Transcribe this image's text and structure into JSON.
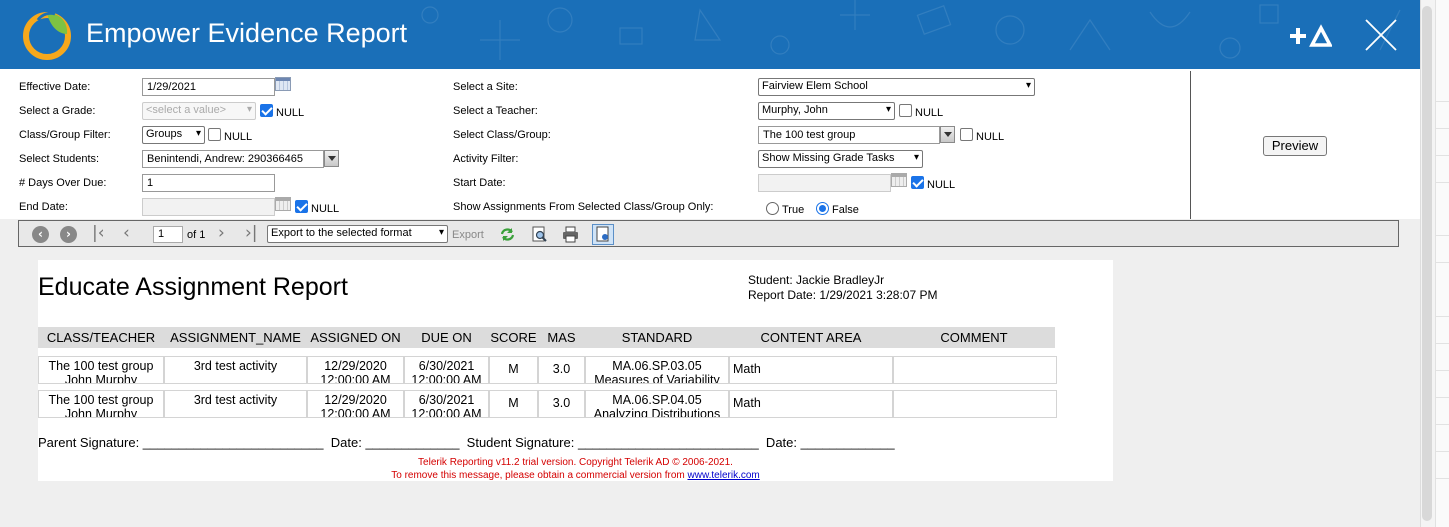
{
  "app": {
    "title": "Empower Evidence Report"
  },
  "params": {
    "effective_date": {
      "label": "Effective Date:",
      "value": "1/29/2021"
    },
    "grade": {
      "label": "Select a Grade:",
      "value": "<select a value>",
      "null_label": "NULL",
      "null_checked": true
    },
    "class_group_filter": {
      "label": "Class/Group Filter:",
      "value": "Groups",
      "null_label": "NULL",
      "null_checked": false
    },
    "students": {
      "label": "Select Students:",
      "value": "Benintendi, Andrew: 290366465"
    },
    "days_over_due": {
      "label": "# Days Over Due:",
      "value": "1"
    },
    "end_date": {
      "label": "End Date:",
      "value": "",
      "null_label": "NULL",
      "null_checked": true
    },
    "site": {
      "label": "Select a Site:",
      "value": "Fairview Elem School"
    },
    "teacher": {
      "label": "Select a Teacher:",
      "value": "Murphy, John",
      "null_label": "NULL",
      "null_checked": false
    },
    "class_group": {
      "label": "Select Class/Group:",
      "value": "The 100 test group",
      "null_label": "NULL",
      "null_checked": false
    },
    "activity_filter": {
      "label": "Activity Filter:",
      "value": "Show Missing Grade Tasks"
    },
    "start_date": {
      "label": "Start Date:",
      "value": "",
      "null_label": "NULL",
      "null_checked": true
    },
    "show_assignments": {
      "label": "Show Assignments From Selected Class/Group Only:",
      "true_label": "True",
      "false_label": "False",
      "selected": "False"
    },
    "preview_label": "Preview"
  },
  "toolbar": {
    "page_value": "1",
    "page_of": "of 1",
    "export_format": "Export to the selected format",
    "export_label": "Export"
  },
  "report": {
    "title": "Educate Assignment Report",
    "student_line": "Student: Jackie BradleyJr",
    "report_date_line": "Report Date: 1/29/2021 3:28:07 PM",
    "columns": [
      "CLASS/TEACHER",
      "ASSIGNMENT_NAME",
      "ASSIGNED ON",
      "DUE ON",
      "SCORE",
      "MAS",
      "STANDARD",
      "CONTENT AREA",
      "COMMENT"
    ],
    "rows": [
      {
        "class_line1": "The 100 test group",
        "class_line2": "John Murphy",
        "assignment": "3rd test activity",
        "assigned_line1": "12/29/2020",
        "assigned_line2": "12:00:00 AM",
        "due_line1": "6/30/2021",
        "due_line2": "12:00:00 AM",
        "score": "M",
        "mas": "3.0",
        "standard_line1": "MA.06.SP.03.05",
        "standard_line2": "Measures of Variability",
        "content_area": "Math",
        "comment": ""
      },
      {
        "class_line1": "The 100 test group",
        "class_line2": "John Murphy",
        "assignment": "3rd test activity",
        "assigned_line1": "12/29/2020",
        "assigned_line2": "12:00:00 AM",
        "due_line1": "6/30/2021",
        "due_line2": "12:00:00 AM",
        "score": "M",
        "mas": "3.0",
        "standard_line1": "MA.06.SP.04.05",
        "standard_line2": "Analyzing Distributions",
        "content_area": "Math",
        "comment": ""
      }
    ],
    "signature_line": "Parent Signature: _________________________  Date: _____________  Student Signature: _________________________  Date: _____________",
    "trial_line1": "Telerik Reporting v11.2 trial version. Copyright Telerik AD © 2006-2021.",
    "trial_line2": "To remove this message, please obtain a commercial version from",
    "trial_link": "www.telerik.com"
  },
  "colors": {
    "header": "#1a6fb8",
    "accent": "#1a73e8",
    "trial_text": "#d40000"
  }
}
